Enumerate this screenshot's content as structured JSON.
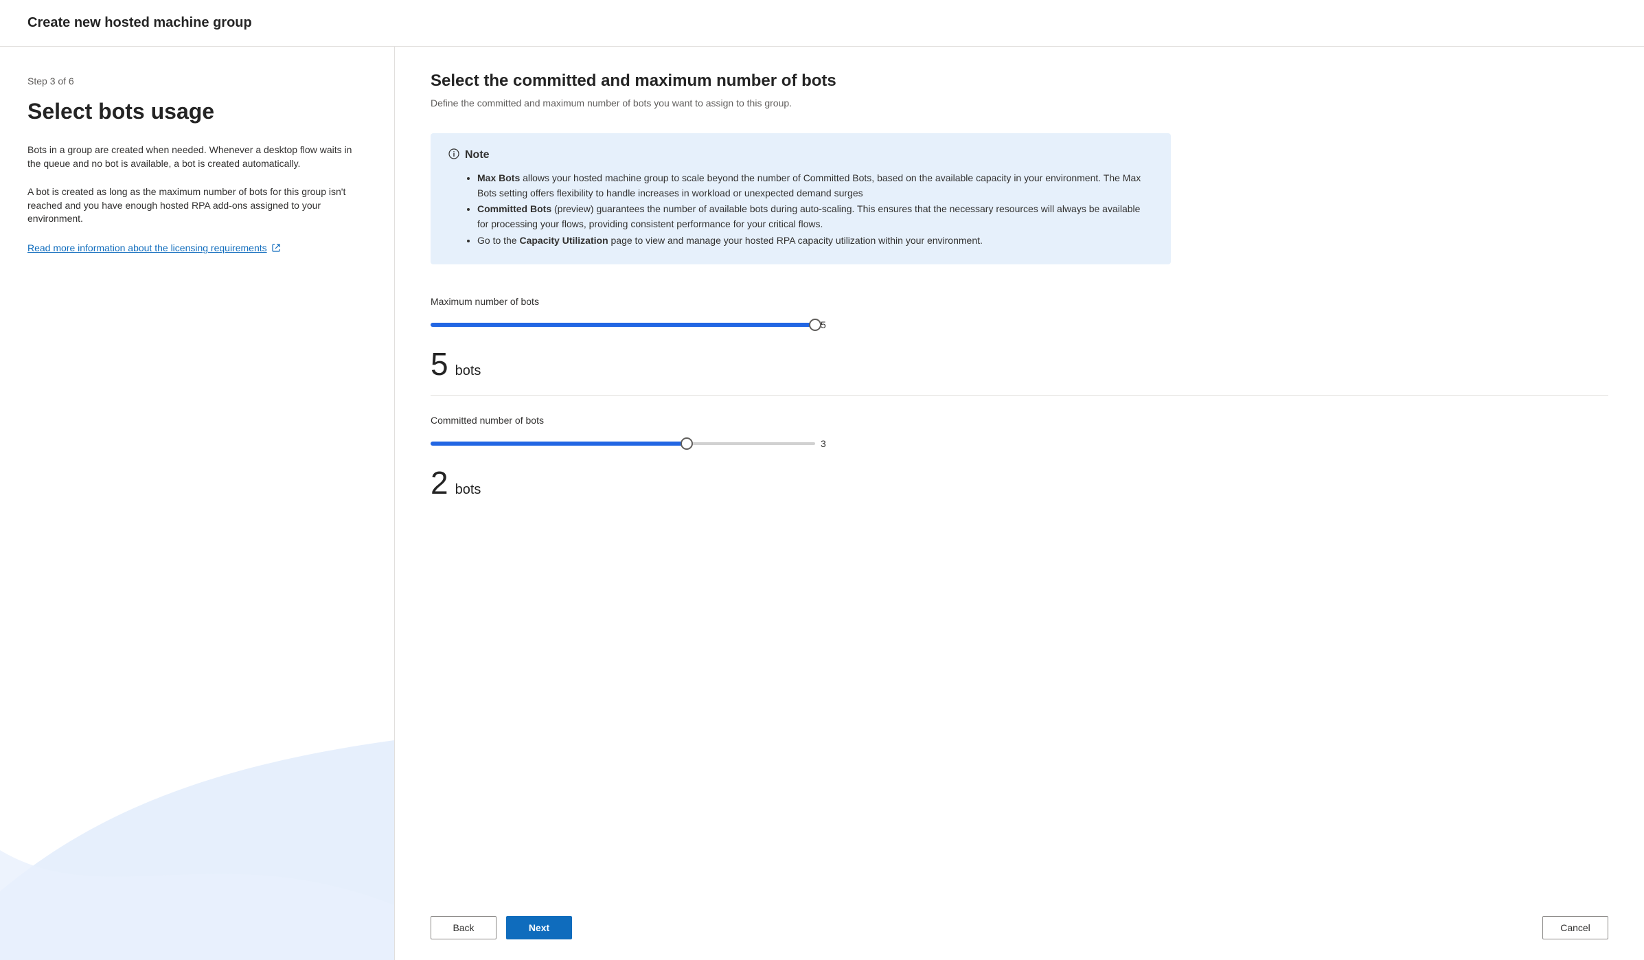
{
  "header": {
    "title": "Create new hosted machine group"
  },
  "sidebar": {
    "step_label": "Step 3 of 6",
    "title": "Select bots usage",
    "paragraph1": "Bots in a group are created when needed. Whenever a desktop flow waits in the queue and no bot is available, a bot is created automatically.",
    "paragraph2": "A bot is created as long as the maximum number of bots for this group isn't reached and you have enough hosted RPA add-ons assigned to your environment.",
    "link_text": "Read more information about the licensing requirements"
  },
  "main": {
    "title": "Select the committed and maximum number of bots",
    "subtitle": "Define the committed and maximum number of bots you want to assign to this group.",
    "note": {
      "label": "Note",
      "item1_strong": "Max Bots",
      "item1_text": " allows your hosted machine group to scale beyond the number of Committed Bots, based on the available capacity in your environment. The Max Bots setting offers flexibility to handle increases in workload or unexpected demand surges",
      "item2_strong": "Committed Bots",
      "item2_text": " (preview) guarantees the number of available bots during auto-scaling. This ensures that the necessary resources will always be available for processing your flows, providing consistent performance for your critical flows.",
      "item3_prefix": "Go to the ",
      "item3_strong": "Capacity Utilization",
      "item3_text": " page to view and manage your hosted RPA capacity utilization within your environment."
    },
    "max_bots": {
      "label": "Maximum number of bots",
      "value": "5",
      "max": "5",
      "unit": "bots"
    },
    "committed_bots": {
      "label": "Committed number of bots",
      "value": "2",
      "max": "3",
      "unit": "bots"
    }
  },
  "footer": {
    "back": "Back",
    "next": "Next",
    "cancel": "Cancel"
  }
}
